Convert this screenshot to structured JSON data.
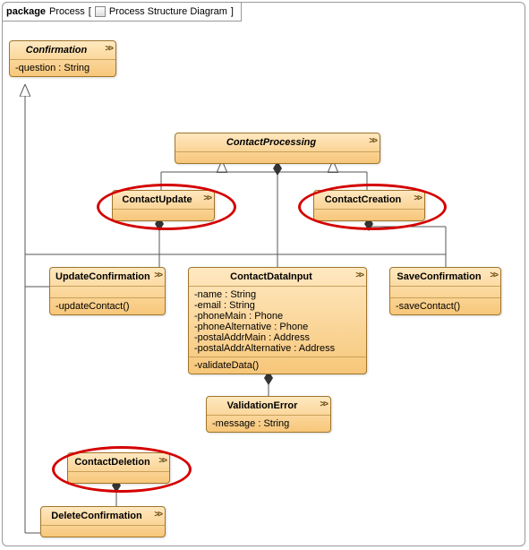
{
  "package": {
    "keyword": "package",
    "name": "Process",
    "diagramType": "Process Structure Diagram"
  },
  "classes": {
    "Confirmation": {
      "name": "Confirmation",
      "attrs": [
        "-question : String"
      ]
    },
    "ContactProcessing": {
      "name": "ContactProcessing"
    },
    "ContactUpdate": {
      "name": "ContactUpdate"
    },
    "ContactCreation": {
      "name": "ContactCreation"
    },
    "UpdateConfirmation": {
      "name": "UpdateConfirmation",
      "ops": [
        "-updateContact()"
      ]
    },
    "SaveConfirmation": {
      "name": "SaveConfirmation",
      "ops": [
        "-saveContact()"
      ]
    },
    "ContactDataInput": {
      "name": "ContactDataInput",
      "attrs": [
        "-name : String",
        "-email : String",
        "-phoneMain : Phone",
        "-phoneAlternative : Phone",
        "-postalAddrMain : Address",
        "-postalAddrAlternative : Address"
      ],
      "ops": [
        "-validateData()"
      ]
    },
    "ValidationError": {
      "name": "ValidationError",
      "attrs": [
        "-message : String"
      ]
    },
    "ContactDeletion": {
      "name": "ContactDeletion"
    },
    "DeleteConfirmation": {
      "name": "DeleteConfirmation"
    }
  },
  "chart_data": {
    "type": "diagram",
    "title": "Process Structure Diagram",
    "nodes": [
      {
        "id": "Confirmation",
        "abstract": true,
        "attributes": [
          "question : String"
        ]
      },
      {
        "id": "ContactProcessing",
        "abstract": true
      },
      {
        "id": "ContactUpdate",
        "highlighted": true
      },
      {
        "id": "ContactCreation",
        "highlighted": true
      },
      {
        "id": "UpdateConfirmation",
        "operations": [
          "updateContact()"
        ]
      },
      {
        "id": "SaveConfirmation",
        "operations": [
          "saveContact()"
        ]
      },
      {
        "id": "ContactDataInput",
        "attributes": [
          "name : String",
          "email : String",
          "phoneMain : Phone",
          "phoneAlternative : Phone",
          "postalAddrMain : Address",
          "postalAddrAlternative : Address"
        ],
        "operations": [
          "validateData()"
        ]
      },
      {
        "id": "ValidationError",
        "attributes": [
          "message : String"
        ]
      },
      {
        "id": "ContactDeletion",
        "highlighted": true
      },
      {
        "id": "DeleteConfirmation"
      }
    ],
    "edges": [
      {
        "from": "ContactUpdate",
        "to": "ContactProcessing",
        "type": "generalization"
      },
      {
        "from": "ContactCreation",
        "to": "ContactProcessing",
        "type": "generalization"
      },
      {
        "from": "UpdateConfirmation",
        "to": "Confirmation",
        "type": "generalization"
      },
      {
        "from": "SaveConfirmation",
        "to": "Confirmation",
        "type": "generalization"
      },
      {
        "from": "DeleteConfirmation",
        "to": "Confirmation",
        "type": "generalization"
      },
      {
        "from": "ContactUpdate",
        "to": "UpdateConfirmation",
        "type": "composition"
      },
      {
        "from": "ContactCreation",
        "to": "SaveConfirmation",
        "type": "composition"
      },
      {
        "from": "ContactProcessing",
        "to": "ContactDataInput",
        "type": "composition"
      },
      {
        "from": "ContactDataInput",
        "to": "ValidationError",
        "type": "composition"
      },
      {
        "from": "ContactDeletion",
        "to": "DeleteConfirmation",
        "type": "composition"
      }
    ]
  }
}
